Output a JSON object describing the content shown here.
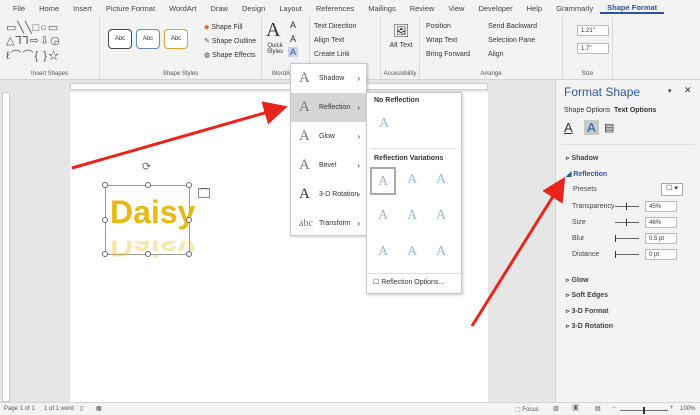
{
  "tabs": [
    "File",
    "Home",
    "Insert",
    "Picture Format",
    "WordArt",
    "Draw",
    "Design",
    "Layout",
    "References",
    "Mailings",
    "Review",
    "View",
    "Developer",
    "Help",
    "Grammarly",
    "Shape Format"
  ],
  "ribbon": {
    "insert_shapes": "Insert Shapes",
    "shape_styles": {
      "label": "Shape Styles",
      "previews": [
        "Abc",
        "Abc",
        "Abc"
      ],
      "fill": "Shape Fill",
      "outline": "Shape Outline",
      "effects": "Shape Effects"
    },
    "wordart": {
      "label": "WordArt S",
      "quick_styles": "Quick Styles"
    },
    "text": {
      "direction": "Text Direction",
      "align": "Align Text",
      "link": "Create Link"
    },
    "accessibility": {
      "label": "Accessibility",
      "alt_text": "Alt Text"
    },
    "arrange": {
      "label": "Arrange",
      "position": "Position",
      "wrap": "Wrap Text",
      "forward": "Bring Forward",
      "backward": "Send Backward",
      "pane": "Selection Pane",
      "align": "Align"
    },
    "size": {
      "label": "Size",
      "height": "1.21\"",
      "width": "1.7\""
    }
  },
  "document": {
    "word": "Daisy"
  },
  "effects_menu": {
    "items": [
      "Shadow",
      "Reflection",
      "Glow",
      "Bevel",
      "3-D Rotation",
      "Transform"
    ],
    "selected": "Reflection"
  },
  "reflection_submenu": {
    "no_reflection": "No Reflection",
    "variations": "Reflection Variations",
    "options": "Reflection Options..."
  },
  "pane": {
    "title": "Format Shape",
    "tab1": "Shape Options",
    "tab2": "Text Options",
    "sections": [
      "Shadow",
      "Reflection",
      "Glow",
      "Soft Edges",
      "3-D Format",
      "3-D Rotation"
    ],
    "presets": "Presets",
    "props": [
      {
        "label": "Transparency",
        "value": "45%",
        "slider": 0.45
      },
      {
        "label": "Size",
        "value": "46%",
        "slider": 0.46
      },
      {
        "label": "Blur",
        "value": "0.5 pt",
        "slider": 0.0
      },
      {
        "label": "Distance",
        "value": "0 pt",
        "slider": 0.0
      }
    ]
  },
  "status": {
    "page": "Page 1 of 1",
    "words": "1 of 1 word",
    "focus": "Focus",
    "zoom": "100%"
  },
  "colors": {
    "accent": "#2b579a",
    "arrow": "#e8241b",
    "text_fill": "#e8b816"
  }
}
